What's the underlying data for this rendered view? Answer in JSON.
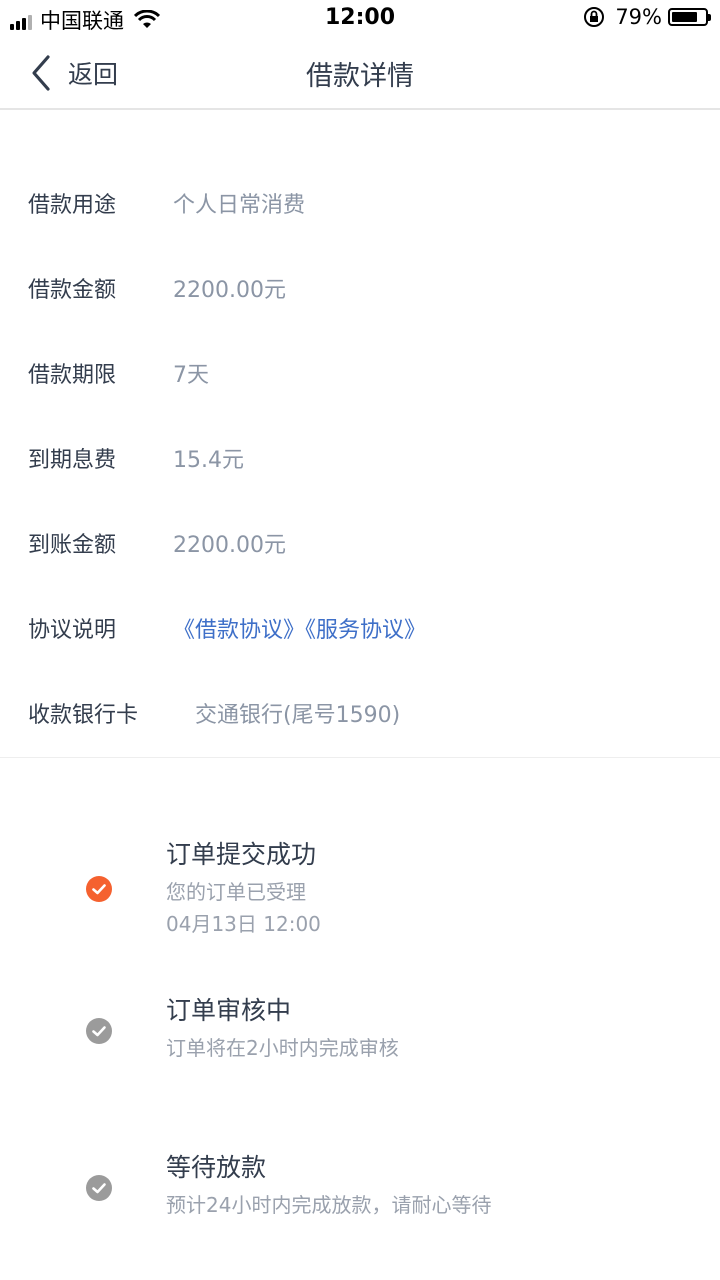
{
  "status_bar": {
    "carrier": "中国联通",
    "time": "12:00",
    "battery_percent": "79%",
    "battery_level": 0.79,
    "icons": [
      "signal-icon",
      "wifi-icon",
      "orientation-lock-icon",
      "battery-icon"
    ]
  },
  "nav": {
    "back_label": "返回",
    "title": "借款详情",
    "icons": [
      "chevron-left-icon"
    ]
  },
  "details": {
    "purpose": {
      "label": "借款用途",
      "value": "个人日常消费"
    },
    "amount": {
      "label": "借款金额",
      "value": "2200.00元"
    },
    "term": {
      "label": "借款期限",
      "value": "7天"
    },
    "interest": {
      "label": "到期息费",
      "value": "15.4元"
    },
    "received": {
      "label": "到账金额",
      "value": "2200.00元"
    },
    "agreement": {
      "label": "协议说明",
      "link1": "《借款协议》",
      "link2": "《服务协议》"
    },
    "bank_card": {
      "label": "收款银行卡",
      "value": "交通银行(尾号1590)"
    }
  },
  "timeline": [
    {
      "title": "订单提交成功",
      "desc": "您的订单已受理",
      "time": "04月13日 12:00",
      "status": "done",
      "color": "#f5612f"
    },
    {
      "title": "订单审核中",
      "desc": "订单将在2小时内完成审核",
      "status": "pending",
      "color": "#9b9b9b"
    },
    {
      "title": "等待放款",
      "desc": "预计24小时内完成放款，请耐心等待",
      "status": "pending",
      "color": "#9b9b9b"
    }
  ],
  "colors": {
    "accent": "#f5612f",
    "link": "#3e6fc8",
    "muted": "#8b95a5",
    "text": "#333d4d"
  }
}
